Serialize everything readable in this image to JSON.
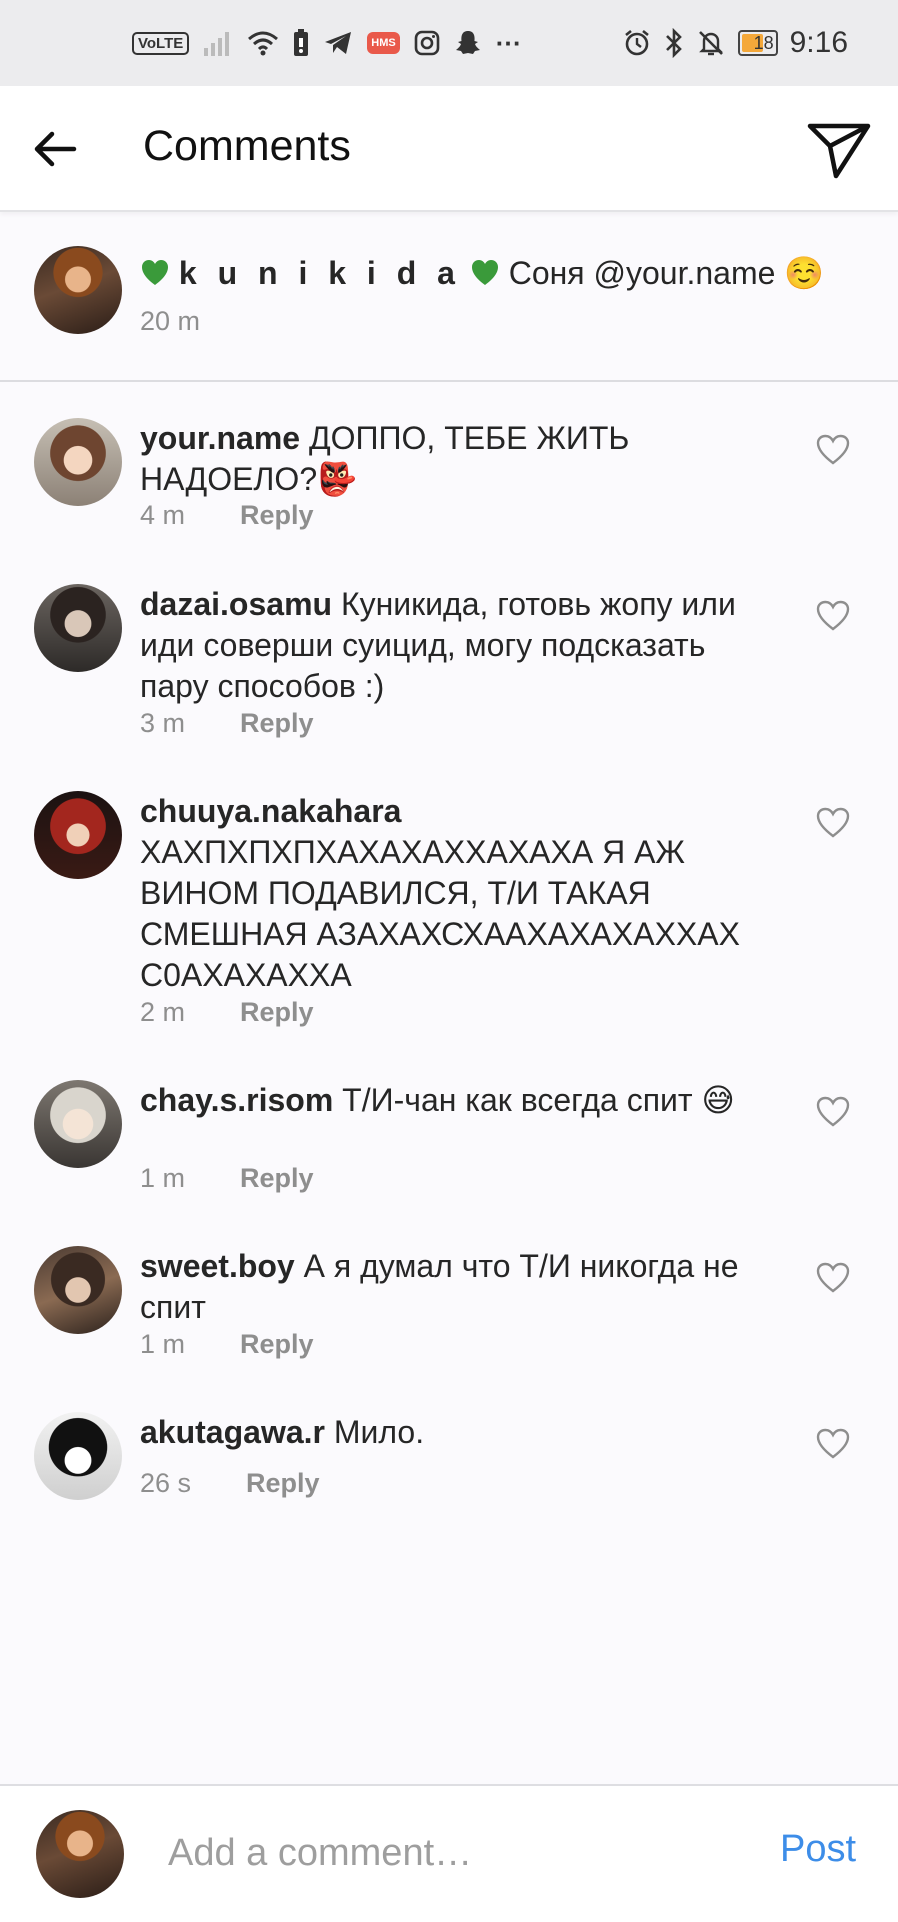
{
  "status_bar": {
    "volte": "VoLTE",
    "hms": "HMS",
    "dots": "···",
    "battery": "18",
    "time": "9:16",
    "battery_color": "#f4a83a"
  },
  "header": {
    "title": "Comments",
    "back_icon": "arrow-left-icon",
    "send_icon": "paper-plane-icon"
  },
  "caption": {
    "username": "k u n i k i d a",
    "text": "Соня @your.name ☺️",
    "time": "20 m"
  },
  "comments": [
    {
      "username": "your.name",
      "text": "ДОППО, ТЕБЕ ЖИТЬ НАДОЕЛО?👺",
      "time": "4 m",
      "reply": "Reply"
    },
    {
      "username": "dazai.osamu",
      "text": "Куникида, готовь жопу или иди соверши суицид, могу подсказать пару способов :)",
      "time": "3 m",
      "reply": "Reply"
    },
    {
      "username": "chuuya.nakahara",
      "text": "ХАХПХПХПХАХАХАХХАХАХА Я АЖ ВИНОМ ПОДАВИЛСЯ, Т/И ТАКАЯ СМЕШНАЯ АЗАХАХСХААХАХАХАХХАХ С0АХАХАХХА",
      "time": "2 m",
      "reply": "Reply"
    },
    {
      "username": "chay.s.risom",
      "text": "Т/И-чан как всегда спит 😅",
      "time": "1 m",
      "reply": "Reply"
    },
    {
      "username": "sweet.boy",
      "text": "А я думал что Т/И никогда не спит",
      "time": "1 m",
      "reply": "Reply"
    },
    {
      "username": "akutagawa.r",
      "text": "Мило.",
      "time": "26 s",
      "reply": "Reply"
    }
  ],
  "composer": {
    "placeholder": "Add a comment…",
    "post": "Post",
    "post_color": "#3d8de8"
  }
}
